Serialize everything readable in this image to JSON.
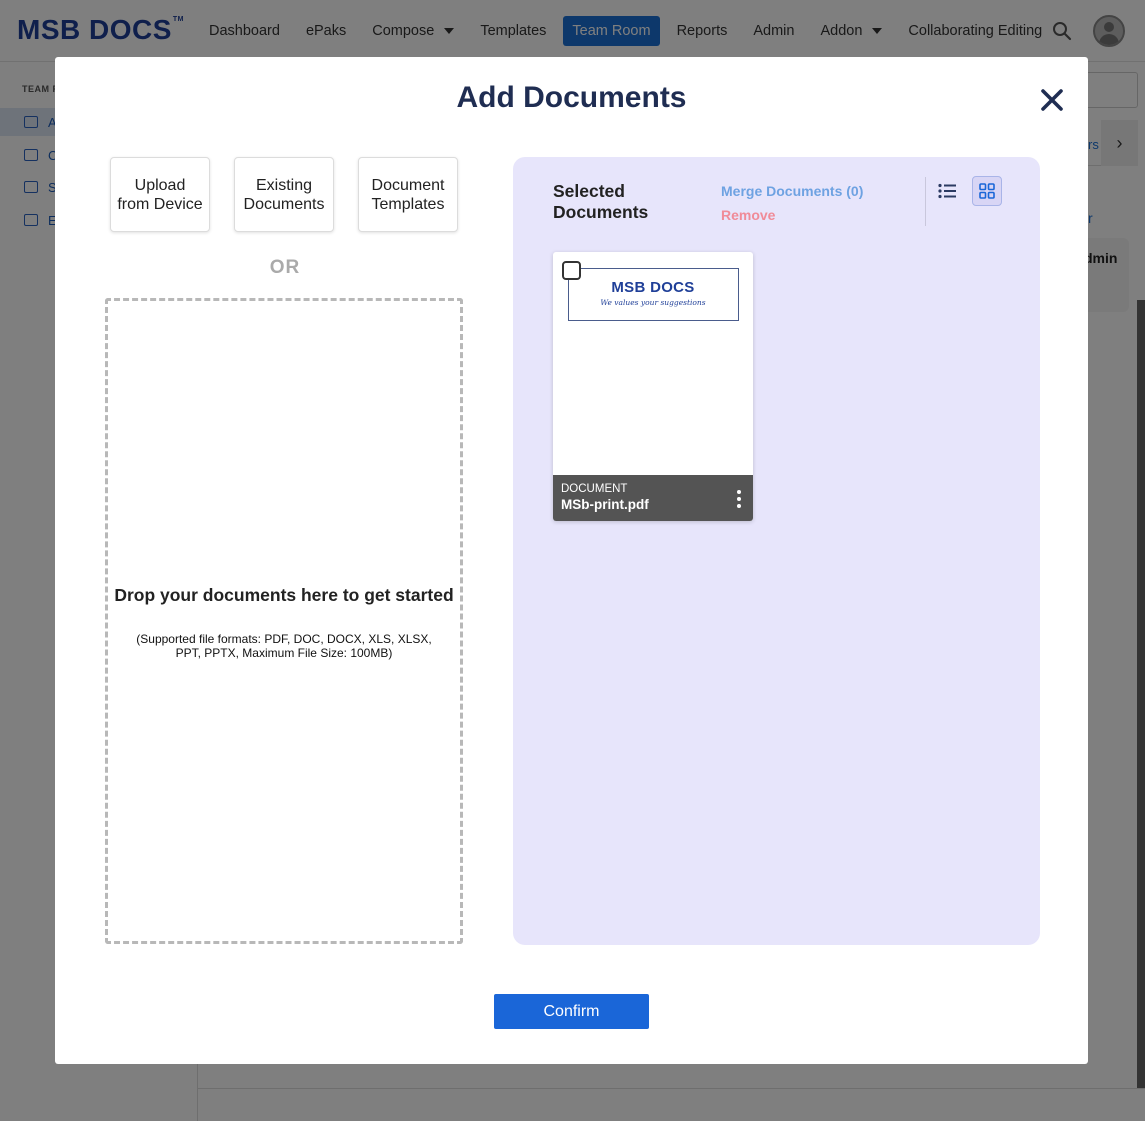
{
  "app": {
    "logo_text": "MSB DOCS",
    "logo_tm": "TM",
    "nav": [
      {
        "label": "Dashboard"
      },
      {
        "label": "ePaks"
      },
      {
        "label": "Compose",
        "has_dropdown": true
      },
      {
        "label": "Templates"
      },
      {
        "label": "Team Room",
        "active": true
      },
      {
        "label": "Reports"
      },
      {
        "label": "Admin"
      },
      {
        "label": "Addon",
        "has_dropdown": true
      },
      {
        "label": "Collaborating Editing"
      }
    ],
    "icons": {
      "search": "search-icon",
      "avatar": "user-avatar-icon"
    },
    "accent_color": "#1a70d6",
    "brand_color": "#1f3f98"
  },
  "background": {
    "sidebar_header": "TEAM R",
    "sidebar_rows": [
      "A",
      "C",
      "S",
      "E"
    ],
    "tab_fragment": "rs",
    "link_fragment": "r",
    "card_fragment": "dmin"
  },
  "modal": {
    "title": "Add Documents",
    "close_icon": "close-icon",
    "sources": [
      {
        "label": "Upload from Device"
      },
      {
        "label": "Existing Documents"
      },
      {
        "label": "Document Templates"
      }
    ],
    "or_label": "OR",
    "dropzone": {
      "title": "Drop your documents here to get started",
      "note": "(Supported file formats: PDF, DOC, DOCX, XLS, XLSX, PPT, PPTX, Maximum File Size: 100MB)"
    },
    "selected": {
      "title": "Selected Documents",
      "merge_label": "Merge Documents (0)",
      "remove_label": "Remove",
      "view_modes": [
        {
          "name": "list-view-icon",
          "active": false
        },
        {
          "name": "grid-view-icon",
          "active": true
        }
      ],
      "panel_color": "#e7e5fb",
      "documents": [
        {
          "type": "DOCUMENT",
          "name": "MSb-print.pdf",
          "thumbnail_logo": "MSB DOCS",
          "thumbnail_tagline": "We values your suggestions",
          "checked": false
        }
      ]
    },
    "confirm_label": "Confirm"
  }
}
